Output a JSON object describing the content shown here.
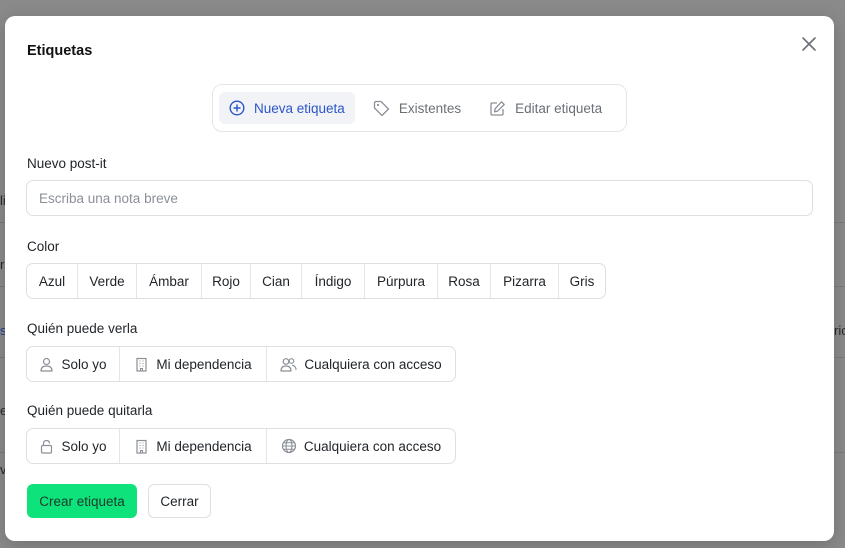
{
  "background": {
    "fragments": [
      "li",
      "r",
      "s",
      "e",
      "v",
      "ric"
    ]
  },
  "modal": {
    "title": "Etiquetas",
    "close_icon": "close-icon",
    "tabs": [
      {
        "label": "Nueva etiqueta",
        "icon": "plus-circle-icon",
        "active": true
      },
      {
        "label": "Existentes",
        "icon": "tag-icon",
        "active": false
      },
      {
        "label": "Editar etiqueta",
        "icon": "edit-icon",
        "active": false
      }
    ],
    "note": {
      "label": "Nuevo post-it",
      "placeholder": "Escriba una nota breve",
      "value": ""
    },
    "color": {
      "label": "Color",
      "options": [
        "Azul",
        "Verde",
        "Ámbar",
        "Rojo",
        "Cian",
        "Índigo",
        "Púrpura",
        "Rosa",
        "Pizarra",
        "Gris"
      ]
    },
    "visibility": {
      "label": "Quién puede verla",
      "options": [
        {
          "label": "Solo yo",
          "icon": "user-icon"
        },
        {
          "label": "Mi dependencia",
          "icon": "building-icon"
        },
        {
          "label": "Cualquiera con acceso",
          "icon": "users-icon"
        }
      ]
    },
    "removal": {
      "label": "Quién puede quitarla",
      "options": [
        {
          "label": "Solo yo",
          "icon": "lock-icon"
        },
        {
          "label": "Mi dependencia",
          "icon": "building-icon"
        },
        {
          "label": "Cualquiera con acceso",
          "icon": "globe-icon"
        }
      ]
    },
    "actions": {
      "create_label": "Crear etiqueta",
      "close_label": "Cerrar"
    },
    "colors": {
      "accent": "#2c55c9",
      "primary_button": "#0ee27a",
      "primary_button_text": "#1c3b2a"
    }
  }
}
